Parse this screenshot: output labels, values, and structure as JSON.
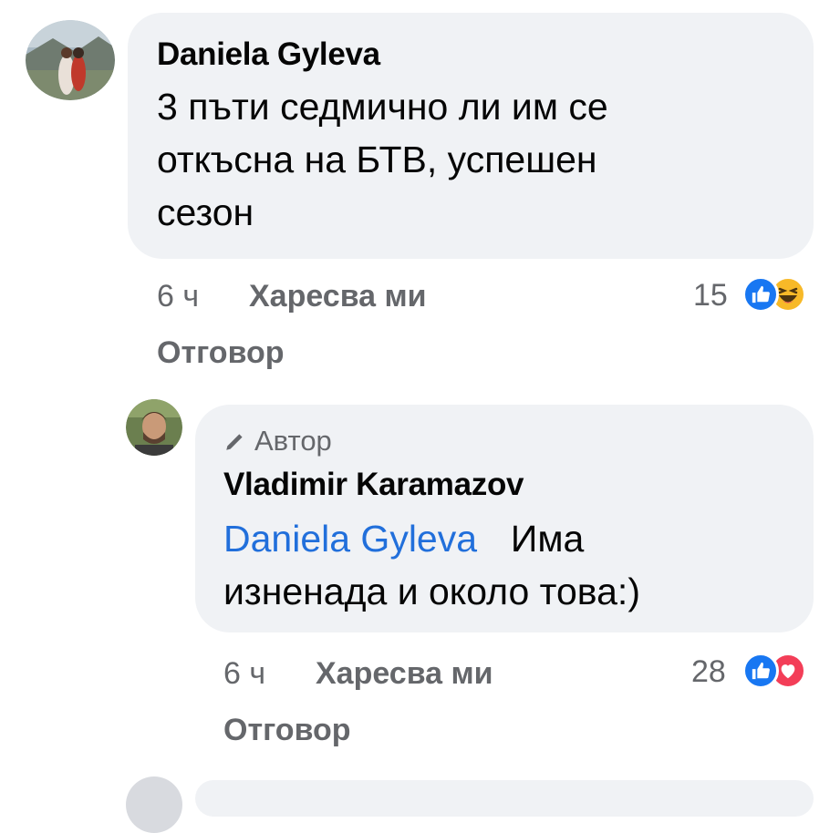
{
  "comments": [
    {
      "author": "Daniela Gyleva",
      "text_lines": [
        "3 пъти седмично ли им се",
        "откъсна на БТВ, успешен",
        "сезон"
      ],
      "time": "6 ч",
      "like_label": "Харесва ми",
      "reply_label": "Отговор",
      "reaction_count": "15",
      "reactions": [
        "like-icon",
        "haha-icon"
      ]
    },
    {
      "badge": "Автор",
      "author": "Vladimir Karamazov",
      "mention": "Daniela Gyleva",
      "text_first": "Има",
      "text_second": "изненада и около това:)",
      "time": "6 ч",
      "like_label": "Харесва ми",
      "reply_label": "Отговор",
      "reaction_count": "28",
      "reactions": [
        "like-icon",
        "love-icon"
      ]
    }
  ],
  "colors": {
    "bubble": "#f0f2f5",
    "meta": "#65676b",
    "mention": "#216fdb",
    "like_blue": "#1877f2",
    "love_red": "#f33e58",
    "haha_yellow": "#f7b928"
  }
}
